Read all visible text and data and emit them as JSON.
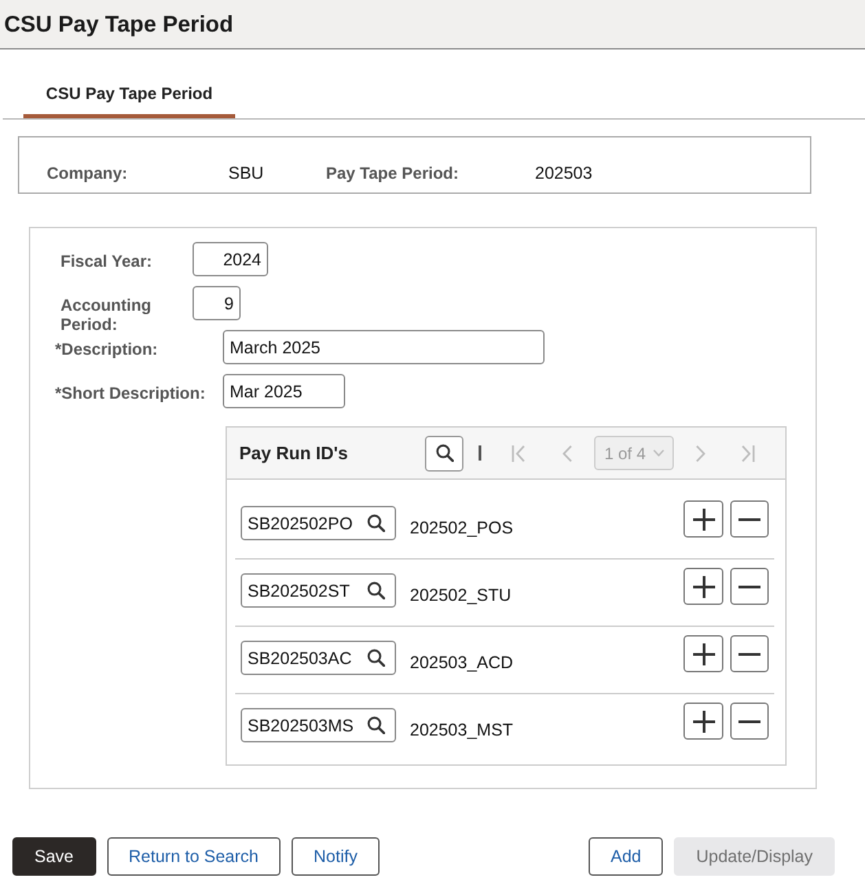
{
  "page_title": "CSU Pay Tape Period",
  "tabs": [
    {
      "label": "CSU Pay Tape Period",
      "selected": true
    }
  ],
  "summary": [
    {
      "label": "Company:",
      "value": "SBU"
    },
    {
      "label": "Pay Tape Period:",
      "value": "202503"
    }
  ],
  "fields": [
    {
      "label": "Fiscal Year:",
      "value": "2024",
      "kind": "number"
    },
    {
      "label": "Accounting Period:",
      "value": "9",
      "kind": "number"
    },
    {
      "label": "*Description:",
      "value": "March 2025",
      "kind": "text"
    },
    {
      "label": "*Short Description:",
      "value": "Mar 2025",
      "kind": "text"
    }
  ],
  "pay_run_grid": {
    "title": "Pay Run ID's",
    "navigation": [
      {
        "kind": "first",
        "disabled": true
      },
      {
        "kind": "previous",
        "disabled": true
      },
      {
        "kind": "page",
        "label": "1 of 4",
        "disabled": true
      },
      {
        "kind": "next",
        "disabled": true
      },
      {
        "kind": "last",
        "disabled": true
      }
    ],
    "rows": [
      {
        "pay_run_id": "SB202502PO",
        "description": "202502_POS"
      },
      {
        "pay_run_id": "SB202502ST",
        "description": "202502_STU"
      },
      {
        "pay_run_id": "SB202503AC",
        "description": "202503_ACD"
      },
      {
        "pay_run_id": "SB202503MS",
        "description": "202503_MST"
      }
    ]
  },
  "left_buttons": [
    {
      "label": "Save",
      "kind": "primary",
      "disabled": false
    },
    {
      "label": "Return to Search",
      "kind": "default",
      "disabled": false
    },
    {
      "label": "Notify",
      "kind": "default",
      "disabled": false
    }
  ],
  "right_buttons": [
    {
      "label": "Add",
      "kind": "default",
      "disabled": false
    },
    {
      "label": "Update/Display",
      "kind": "default",
      "disabled": true
    }
  ]
}
